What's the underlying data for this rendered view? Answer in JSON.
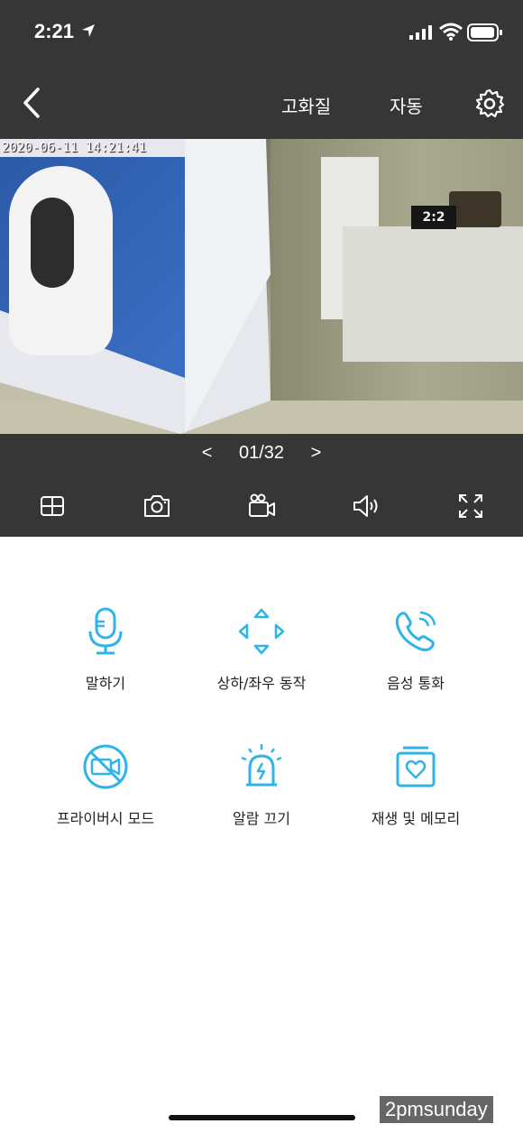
{
  "status": {
    "time": "2:21"
  },
  "nav": {
    "quality": "고화질",
    "auto": "자동"
  },
  "video": {
    "timestamp": "2020-06-11 14:21:41",
    "clock": "2:2"
  },
  "pager": {
    "prev": "<",
    "current": "01/32",
    "next": ">"
  },
  "toolbar": {
    "icons": [
      "multiview-icon",
      "camera-icon",
      "video-record-icon",
      "speaker-icon",
      "fullscreen-icon"
    ]
  },
  "actions": [
    {
      "label": "말하기",
      "icon": "microphone-icon"
    },
    {
      "label": "상하/좌우 동작",
      "icon": "pan-tilt-icon"
    },
    {
      "label": "음성 통화",
      "icon": "phone-call-icon"
    },
    {
      "label": "프라이버시 모드",
      "icon": "privacy-mode-icon"
    },
    {
      "label": "알람 끄기",
      "icon": "alarm-icon"
    },
    {
      "label": "재생 및 메모리",
      "icon": "playback-icon"
    }
  ],
  "colors": {
    "accent": "#2fb4e9",
    "dark": "#363636"
  },
  "watermark": "2pmsunday"
}
